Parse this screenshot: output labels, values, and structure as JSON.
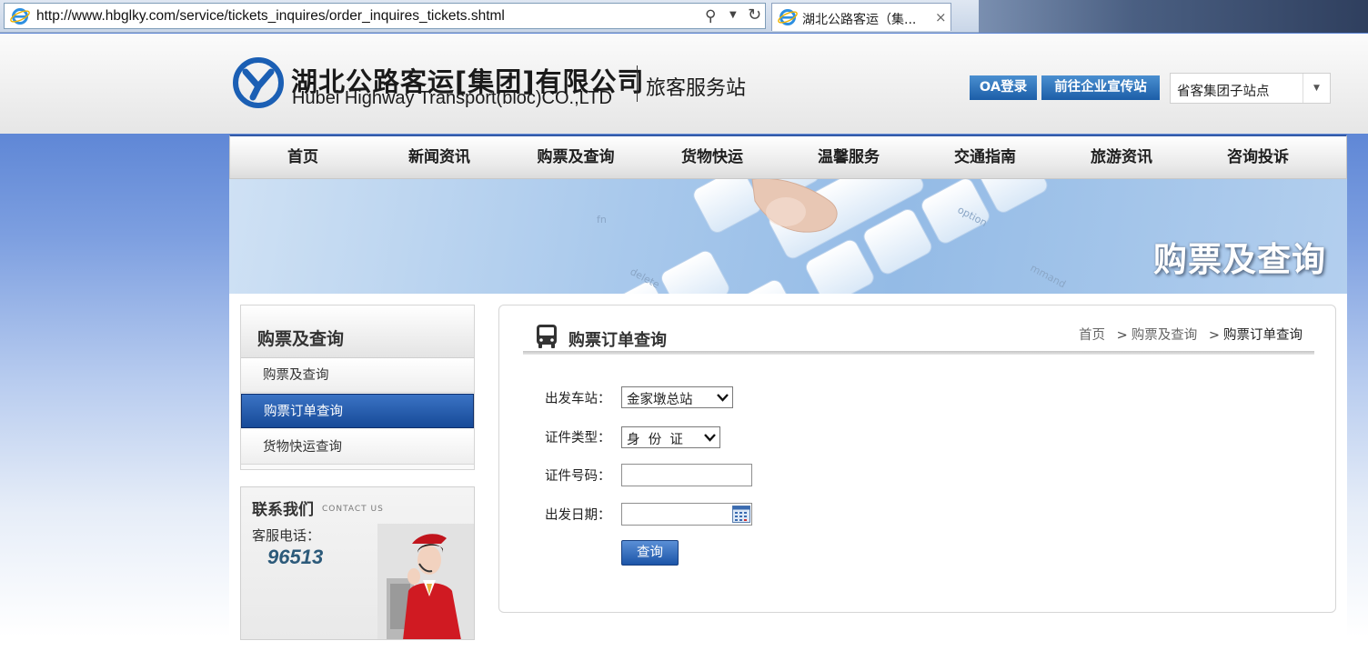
{
  "browser": {
    "url": "http://www.hbglky.com/service/tickets_inquires/order_inquires_tickets.shtml",
    "tab_title": "湖北公路客运（集...",
    "tab_close": "×"
  },
  "header": {
    "brand_cn": "湖北公路客运[集团]有限公司",
    "brand_en": "Hubei Highway Transport(bloc)CO.,LTD",
    "brand_sub": "旅客服务站",
    "oa_label": "OA登录",
    "enterprise_label": "前往企业宣传站",
    "site_select_value": "省客集团子站点"
  },
  "nav": {
    "items": [
      "首页",
      "新闻资讯",
      "购票及查询",
      "货物快运",
      "温馨服务",
      "交通指南",
      "旅游资讯",
      "咨询投诉"
    ]
  },
  "banner": {
    "title": "购票及查询",
    "key_labels": {
      "del": "delete",
      "fn": "fn",
      "option": "option",
      "mand": "mmand"
    }
  },
  "sidebar": {
    "title": "购票及查询",
    "items": [
      "购票及查询",
      "购票订单查询",
      "货物快运查询"
    ],
    "active_index": 1
  },
  "contact": {
    "title": "联系我们",
    "subtitle": "CONTACT US",
    "phone_label": "客服电话：",
    "phone": "96513"
  },
  "panel": {
    "title": "购票订单查询",
    "breadcrumb": [
      "首页",
      "购票及查询",
      "购票订单查询"
    ],
    "breadcrumb_sep": ">"
  },
  "form": {
    "station_label": "出发车站：",
    "station_value": "金家墩总站",
    "id_type_label": "证件类型：",
    "id_type_value": "身  份  证",
    "id_number_label": "证件号码：",
    "id_number_value": "",
    "date_label": "出发日期：",
    "date_value": "",
    "query_label": "查询"
  },
  "colors": {
    "brand_blue": "#1c5ea8",
    "nav_top_border": "#335aa8",
    "active_menu": "#174a98"
  }
}
